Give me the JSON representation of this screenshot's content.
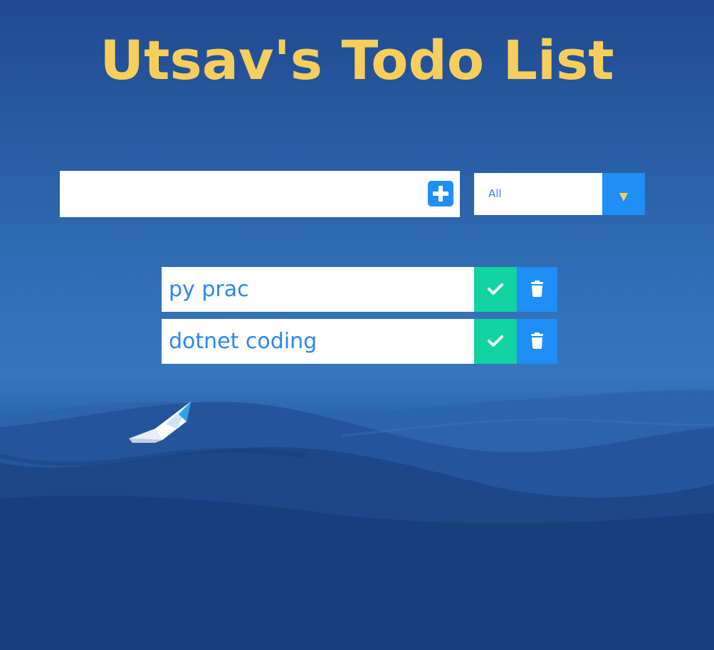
{
  "app": {
    "title": "Utsav's Todo List"
  },
  "form": {
    "input_value": "",
    "input_placeholder": "",
    "add_button_icon": "plus-square-icon",
    "filter": {
      "selected": "All",
      "arrow_icon": "caret-down-icon"
    }
  },
  "todos": [
    {
      "text": "py prac",
      "complete_icon": "check-icon",
      "delete_icon": "trash-icon"
    },
    {
      "text": "dotnet coding",
      "complete_icon": "check-icon",
      "delete_icon": "trash-icon"
    }
  ],
  "colors": {
    "title": "#f7ce5b",
    "accent_blue": "#1f8ef6",
    "complete_green": "#12d4a0",
    "item_text": "#2b86f0",
    "filter_arrow": "#f7ce5b",
    "background": "#2a5fa6"
  }
}
